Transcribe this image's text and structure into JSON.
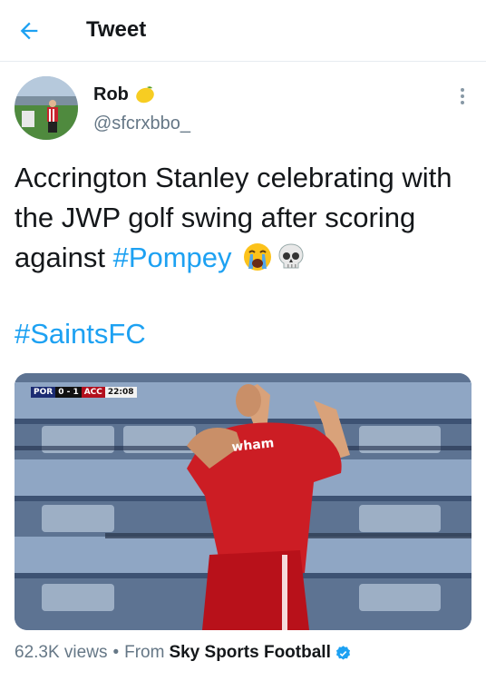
{
  "header": {
    "title": "Tweet",
    "back_icon": "arrow-left-icon"
  },
  "author": {
    "name": "Rob",
    "name_emoji": "lemon-icon",
    "handle": "@sfcrxbbo_"
  },
  "tweet": {
    "text": "Accrington Stanley celebrating with the JWP golf swing after scoring against ",
    "hashtag_inline": "#Pompey",
    "emojis": [
      "loudly-crying-face-icon",
      "skull-icon"
    ],
    "hashtag_line": "#SaintsFC"
  },
  "media": {
    "scorebug": {
      "home": "POR",
      "score": "0 - 1",
      "away": "ACC",
      "time": "22:08"
    }
  },
  "footer": {
    "views": "62.3K views",
    "separator": "•",
    "from_label": "From",
    "source": "Sky Sports Football"
  },
  "colors": {
    "accent": "#1da1f2",
    "secondary_text": "#657786",
    "primary_text": "#14171a"
  }
}
